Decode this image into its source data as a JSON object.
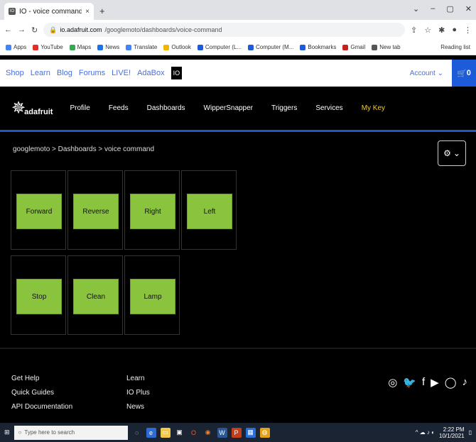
{
  "browser": {
    "tab_title": "IO - voice command",
    "tab_close": "×",
    "new_tab": "+",
    "url_domain": "io.adafruit.com",
    "url_path": "/googlemoto/dashboards/voice-command",
    "bookmarks": [
      {
        "label": "Apps",
        "color": "#4285f4"
      },
      {
        "label": "YouTube",
        "color": "#e52d27"
      },
      {
        "label": "Maps",
        "color": "#34a853"
      },
      {
        "label": "News",
        "color": "#1a73e8"
      },
      {
        "label": "Translate",
        "color": "#4285f4"
      },
      {
        "label": "Outlook",
        "color": "#f4b400"
      },
      {
        "label": "Computer (L...",
        "color": "#1e5bd9"
      },
      {
        "label": "Computer (M...",
        "color": "#1e5bd9"
      },
      {
        "label": "Bookmarks",
        "color": "#1e5bd9"
      },
      {
        "label": "Gmail",
        "color": "#c5221f"
      },
      {
        "label": "New tab",
        "color": "#555555"
      }
    ],
    "reading_list": "Reading list"
  },
  "topstrip": {
    "links": [
      "Shop",
      "Learn",
      "Blog",
      "Forums",
      "LIVE!",
      "AdaBox"
    ],
    "io": "IO",
    "account": "Account",
    "cart": "0"
  },
  "header": {
    "logo_text": "adafruit",
    "nav": [
      "Profile",
      "Feeds",
      "Dashboards",
      "WipperSnapper",
      "Triggers",
      "Services",
      "My Key"
    ]
  },
  "breadcrumb": {
    "user": "googlemoto",
    "sep": ">",
    "section": "Dashboards",
    "page": "voice command"
  },
  "dashboard": {
    "buttons": [
      "Forward",
      "Reverse",
      "Right",
      "Left",
      "Stop",
      "Clean",
      "Lamp"
    ]
  },
  "footer": {
    "col1": [
      "Get Help",
      "Quick Guides",
      "API Documentation"
    ],
    "col2": [
      "Learn",
      "IO Plus",
      "News"
    ]
  },
  "taskbar": {
    "search_placeholder": "Type here to search",
    "time": "2:22 PM",
    "date": "10/1/2021"
  }
}
